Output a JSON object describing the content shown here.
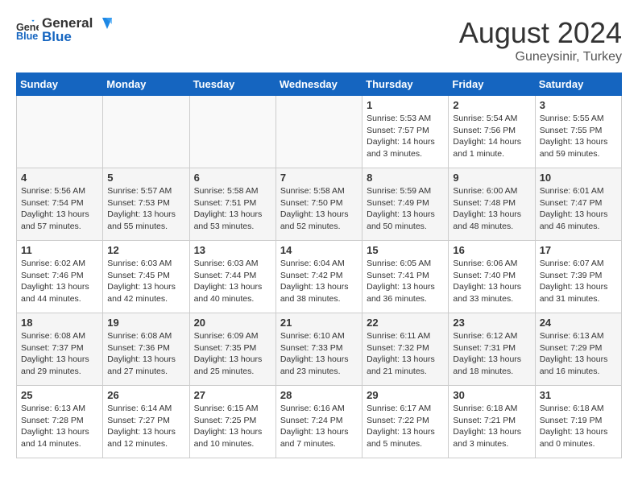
{
  "header": {
    "logo_general": "General",
    "logo_blue": "Blue",
    "month_year": "August 2024",
    "location": "Guneysinir, Turkey"
  },
  "weekdays": [
    "Sunday",
    "Monday",
    "Tuesday",
    "Wednesday",
    "Thursday",
    "Friday",
    "Saturday"
  ],
  "weeks": [
    [
      {
        "day": "",
        "info": ""
      },
      {
        "day": "",
        "info": ""
      },
      {
        "day": "",
        "info": ""
      },
      {
        "day": "",
        "info": ""
      },
      {
        "day": "1",
        "info": "Sunrise: 5:53 AM\nSunset: 7:57 PM\nDaylight: 14 hours\nand 3 minutes."
      },
      {
        "day": "2",
        "info": "Sunrise: 5:54 AM\nSunset: 7:56 PM\nDaylight: 14 hours\nand 1 minute."
      },
      {
        "day": "3",
        "info": "Sunrise: 5:55 AM\nSunset: 7:55 PM\nDaylight: 13 hours\nand 59 minutes."
      }
    ],
    [
      {
        "day": "4",
        "info": "Sunrise: 5:56 AM\nSunset: 7:54 PM\nDaylight: 13 hours\nand 57 minutes."
      },
      {
        "day": "5",
        "info": "Sunrise: 5:57 AM\nSunset: 7:53 PM\nDaylight: 13 hours\nand 55 minutes."
      },
      {
        "day": "6",
        "info": "Sunrise: 5:58 AM\nSunset: 7:51 PM\nDaylight: 13 hours\nand 53 minutes."
      },
      {
        "day": "7",
        "info": "Sunrise: 5:58 AM\nSunset: 7:50 PM\nDaylight: 13 hours\nand 52 minutes."
      },
      {
        "day": "8",
        "info": "Sunrise: 5:59 AM\nSunset: 7:49 PM\nDaylight: 13 hours\nand 50 minutes."
      },
      {
        "day": "9",
        "info": "Sunrise: 6:00 AM\nSunset: 7:48 PM\nDaylight: 13 hours\nand 48 minutes."
      },
      {
        "day": "10",
        "info": "Sunrise: 6:01 AM\nSunset: 7:47 PM\nDaylight: 13 hours\nand 46 minutes."
      }
    ],
    [
      {
        "day": "11",
        "info": "Sunrise: 6:02 AM\nSunset: 7:46 PM\nDaylight: 13 hours\nand 44 minutes."
      },
      {
        "day": "12",
        "info": "Sunrise: 6:03 AM\nSunset: 7:45 PM\nDaylight: 13 hours\nand 42 minutes."
      },
      {
        "day": "13",
        "info": "Sunrise: 6:03 AM\nSunset: 7:44 PM\nDaylight: 13 hours\nand 40 minutes."
      },
      {
        "day": "14",
        "info": "Sunrise: 6:04 AM\nSunset: 7:42 PM\nDaylight: 13 hours\nand 38 minutes."
      },
      {
        "day": "15",
        "info": "Sunrise: 6:05 AM\nSunset: 7:41 PM\nDaylight: 13 hours\nand 36 minutes."
      },
      {
        "day": "16",
        "info": "Sunrise: 6:06 AM\nSunset: 7:40 PM\nDaylight: 13 hours\nand 33 minutes."
      },
      {
        "day": "17",
        "info": "Sunrise: 6:07 AM\nSunset: 7:39 PM\nDaylight: 13 hours\nand 31 minutes."
      }
    ],
    [
      {
        "day": "18",
        "info": "Sunrise: 6:08 AM\nSunset: 7:37 PM\nDaylight: 13 hours\nand 29 minutes."
      },
      {
        "day": "19",
        "info": "Sunrise: 6:08 AM\nSunset: 7:36 PM\nDaylight: 13 hours\nand 27 minutes."
      },
      {
        "day": "20",
        "info": "Sunrise: 6:09 AM\nSunset: 7:35 PM\nDaylight: 13 hours\nand 25 minutes."
      },
      {
        "day": "21",
        "info": "Sunrise: 6:10 AM\nSunset: 7:33 PM\nDaylight: 13 hours\nand 23 minutes."
      },
      {
        "day": "22",
        "info": "Sunrise: 6:11 AM\nSunset: 7:32 PM\nDaylight: 13 hours\nand 21 minutes."
      },
      {
        "day": "23",
        "info": "Sunrise: 6:12 AM\nSunset: 7:31 PM\nDaylight: 13 hours\nand 18 minutes."
      },
      {
        "day": "24",
        "info": "Sunrise: 6:13 AM\nSunset: 7:29 PM\nDaylight: 13 hours\nand 16 minutes."
      }
    ],
    [
      {
        "day": "25",
        "info": "Sunrise: 6:13 AM\nSunset: 7:28 PM\nDaylight: 13 hours\nand 14 minutes."
      },
      {
        "day": "26",
        "info": "Sunrise: 6:14 AM\nSunset: 7:27 PM\nDaylight: 13 hours\nand 12 minutes."
      },
      {
        "day": "27",
        "info": "Sunrise: 6:15 AM\nSunset: 7:25 PM\nDaylight: 13 hours\nand 10 minutes."
      },
      {
        "day": "28",
        "info": "Sunrise: 6:16 AM\nSunset: 7:24 PM\nDaylight: 13 hours\nand 7 minutes."
      },
      {
        "day": "29",
        "info": "Sunrise: 6:17 AM\nSunset: 7:22 PM\nDaylight: 13 hours\nand 5 minutes."
      },
      {
        "day": "30",
        "info": "Sunrise: 6:18 AM\nSunset: 7:21 PM\nDaylight: 13 hours\nand 3 minutes."
      },
      {
        "day": "31",
        "info": "Sunrise: 6:18 AM\nSunset: 7:19 PM\nDaylight: 13 hours\nand 0 minutes."
      }
    ]
  ]
}
